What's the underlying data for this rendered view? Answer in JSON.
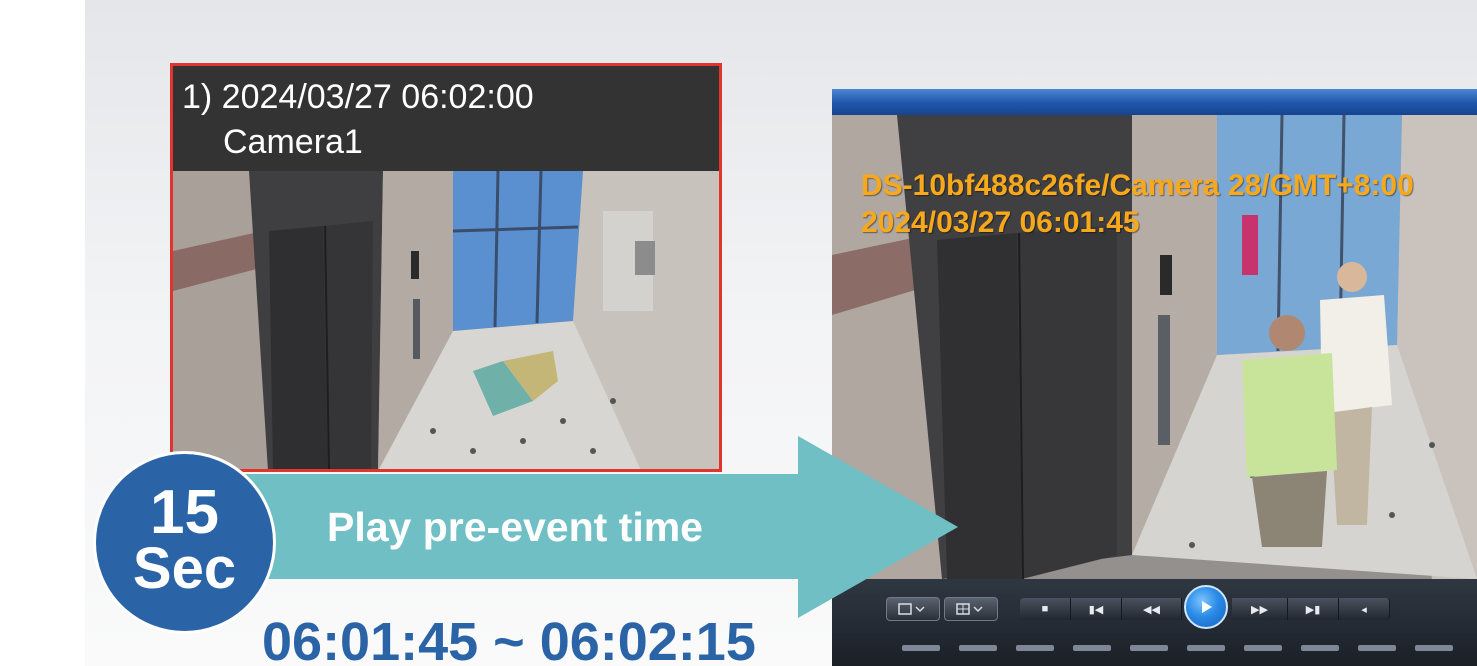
{
  "event_thumbnail": {
    "index_timestamp": "1) 2024/03/27 06:02:00",
    "camera_name": "Camera1",
    "scene": "elevator-lobby-image"
  },
  "player": {
    "osd_device_line": "DS-10bf488c26fe/Camera 28/GMT+8:00",
    "osd_timestamp": "2024/03/27 06:01:45",
    "scene": "elevator-lobby-two-people-image",
    "controls": [
      "layout-1x1-icon",
      "layout-2x2-icon",
      "stop-icon",
      "step-back-icon",
      "rewind-icon",
      "play-icon",
      "fast-forward-icon",
      "step-forward-icon",
      "volume-icon"
    ]
  },
  "callout": {
    "badge_number": "15",
    "badge_unit": "Sec",
    "arrow_label": "Play pre-event time",
    "time_range": "06:01:45 ~ 06:02:15"
  },
  "colors": {
    "thumbnail_border": "#e0342c",
    "arrow": "#6fbfc5",
    "badge": "#2b63a7",
    "time_range": "#2b63a7",
    "osd_text": "#f7a81b",
    "player_titlebar": "#1f55a8"
  }
}
